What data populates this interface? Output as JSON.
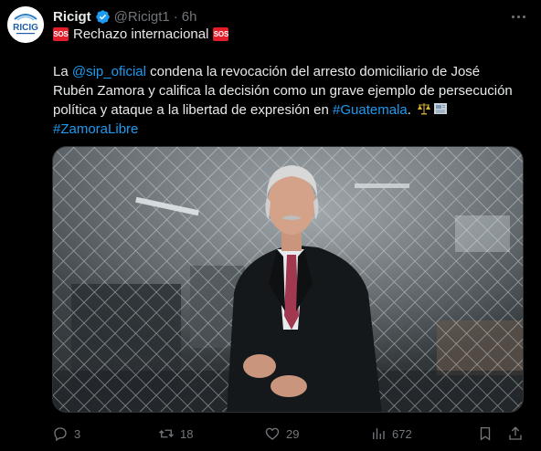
{
  "account": {
    "name": "Ricigt",
    "handle": "@Ricigt1",
    "separator": "·",
    "time": "6h",
    "avatar_text": "RICIG"
  },
  "tweet": {
    "emoji_sos": "SOS",
    "title": "Rechazo internacional",
    "body_prefix": "La ",
    "mention": "@sip_oficial",
    "body_part1": " condena la revocación del arresto domiciliario de José",
    "body_line2": "Rubén Zamora y califica la decisión como un grave ejemplo de persecución",
    "body_line3_prefix": "política y ataque a la libertad de expresión en ",
    "hashtag_guatemala": "#Guatemala",
    "body_line3_suffix": ". ",
    "hashtag_zamora": "#ZamoraLibre"
  },
  "actions": {
    "replies": "3",
    "reposts": "18",
    "likes": "29",
    "views": "672"
  },
  "icons": [
    "verified-badge-icon",
    "more-icon",
    "reply-icon",
    "repost-icon",
    "like-icon",
    "views-icon",
    "bookmark-icon",
    "share-icon",
    "scales-icon",
    "newspaper-icon"
  ],
  "colors": {
    "background": "#000000",
    "text": "#e7e9ea",
    "muted": "#71767b",
    "link": "#1d9bf0",
    "sos": "#e11d2a"
  }
}
